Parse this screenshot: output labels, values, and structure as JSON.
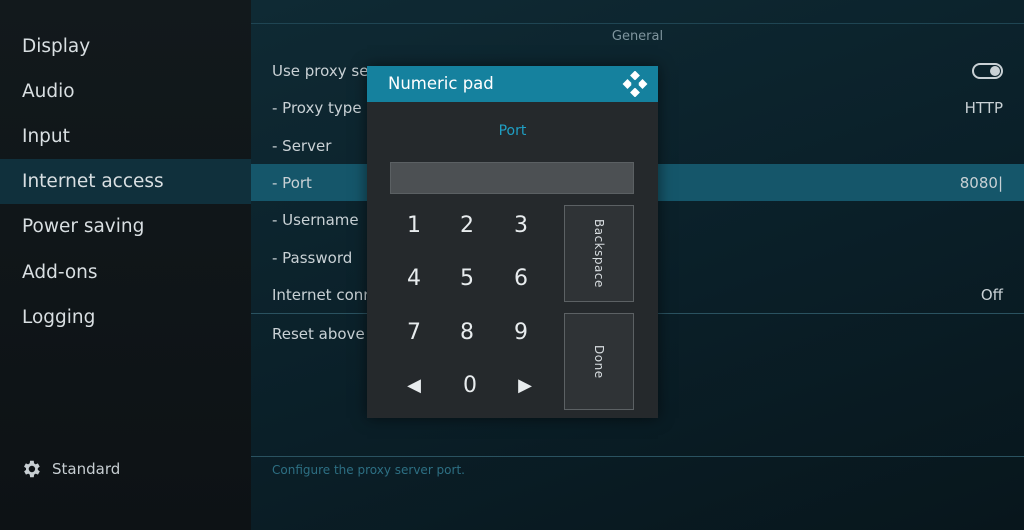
{
  "sidebar": {
    "items": [
      {
        "label": "Display",
        "active": false
      },
      {
        "label": "Audio",
        "active": false
      },
      {
        "label": "Input",
        "active": false
      },
      {
        "label": "Internet access",
        "active": true
      },
      {
        "label": "Power saving",
        "active": false
      },
      {
        "label": "Add-ons",
        "active": false
      },
      {
        "label": "Logging",
        "active": false
      }
    ],
    "footer": {
      "label": "Standard",
      "icon": "gear-icon"
    }
  },
  "main": {
    "section_label": "General",
    "rows": [
      {
        "label": "Use proxy ser",
        "value": "",
        "control": "toggle"
      },
      {
        "label": "- Proxy type",
        "value": "HTTP"
      },
      {
        "label": "- Server",
        "value": ""
      },
      {
        "label": "- Port",
        "value": "8080|"
      },
      {
        "label": "- Username",
        "value": ""
      },
      {
        "label": "- Password",
        "value": ""
      },
      {
        "label": "Internet conn",
        "value": "Off"
      },
      {
        "label": "Reset above s",
        "value": ""
      }
    ],
    "description": "Configure the proxy server port."
  },
  "dialog": {
    "title": "Numeric pad",
    "subtitle": "Port",
    "input_value": "",
    "keys": [
      "1",
      "2",
      "3",
      "4",
      "5",
      "6",
      "7",
      "8",
      "9",
      "0"
    ],
    "left_arrow": "◀",
    "right_arrow": "▶",
    "backspace_label": "Backspace",
    "done_label": "Done",
    "logo": "kodi-logo-icon"
  },
  "colors": {
    "accent": "#15819e",
    "highlight_row": "#15566a",
    "sidebar_active": "#10303c",
    "subtitle": "#1f9fc4"
  }
}
